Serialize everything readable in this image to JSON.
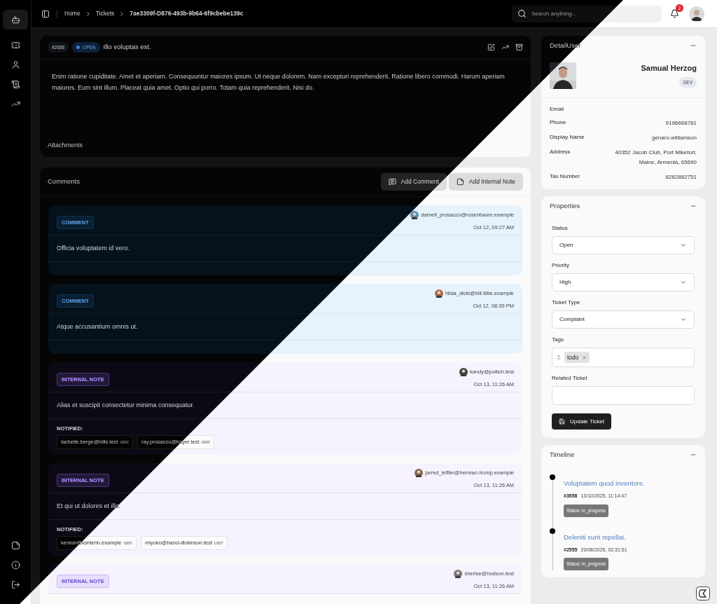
{
  "breadcrumb": [
    "Home",
    "Tickets",
    "7ae3309f-D876-493b-9b64-6f9cbebe139c"
  ],
  "search": {
    "placeholder": "Search anything..."
  },
  "notifications": {
    "count": "2"
  },
  "ticket": {
    "number": "#2658",
    "status": "OPEN",
    "title": "Illo voluptas est.",
    "description": "Enim ratione cupiditate. Amet et aperiam. Consequuntur maiores ipsum. Ut neque dolorem. Nam excepturi reprehenderit. Ratione libero commodi. Harum aperiam maiores. Eum sint illum. Placeat quia amet. Optio qui porro. Totam quia reprehenderit. Nisi do.",
    "attachments_label": "Attachments"
  },
  "comments": {
    "title": "Comments",
    "buttons": [
      {
        "label": "Add Comment",
        "kind": "comment"
      },
      {
        "label": "Add Internal Note",
        "kind": "note"
      }
    ],
    "items": [
      {
        "kind": "comment",
        "badge": "COMMENT",
        "author": "darnell_prosacco@rosenbaum.example",
        "time": "Oct 12, 09:27 AM",
        "body": "Officia voluptatem id vero."
      },
      {
        "kind": "comment",
        "badge": "COMMENT",
        "author": "hilda_dicki@hill-little.example",
        "time": "Oct 12, 08:39 PM",
        "body": "Atque accusantium omnis ut."
      },
      {
        "kind": "note",
        "badge": "INTERNAL NOTE",
        "author": "kandy@pollich.test",
        "time": "Oct 13, 11:26 AM",
        "body": "Alias et suscipit consectetur minima consequatur.",
        "notified_label": "NOTIFIED:",
        "notified": [
          {
            "email": "lachelle.berge@hills.test",
            "tag": "user"
          },
          {
            "email": "ray.prosacco@bayer.test",
            "tag": "user"
          }
        ]
      },
      {
        "kind": "note",
        "badge": "INTERNAL NOTE",
        "author": "jarred_leffler@herman-tromp.example",
        "time": "Oct 13, 11:26 AM",
        "body": "Et qui ut dolores et illo.",
        "notified_label": "NOTIFIED:",
        "notified": [
          {
            "email": "kenton@kshlerin.example",
            "tag": "user"
          },
          {
            "email": "miyoko@hand-dickinson.test",
            "tag": "user"
          }
        ]
      },
      {
        "kind": "note",
        "badge": "INTERNAL NOTE",
        "author": "sherise@hudson.test",
        "time": "Oct 13, 11:26 AM"
      }
    ]
  },
  "detail_user": {
    "title": "DetailUser",
    "name": "Samual Herzog",
    "role": "DEV",
    "fields": [
      {
        "label": "Email"
      },
      {
        "label": "Phone",
        "value": "9196668781"
      },
      {
        "label": "Display Name",
        "value": "genaro.williamson"
      },
      {
        "label": "Address",
        "value": "40352 Jacob Club, Port Mikefort, Maine, Armenia, 65690"
      },
      {
        "label": "Tax Number",
        "value": "8262882751"
      }
    ]
  },
  "properties": {
    "title": "Properties",
    "fields": [
      {
        "kind": "select",
        "label": "Status",
        "value": "Open"
      },
      {
        "kind": "select",
        "label": "Priority",
        "value": "High"
      },
      {
        "kind": "select",
        "label": "Ticket Type",
        "value": "Complaint"
      },
      {
        "kind": "tags",
        "label": "Tags",
        "tags": [
          "todo"
        ]
      },
      {
        "kind": "input",
        "label": "Related Ticket"
      }
    ],
    "button": "Update Ticket"
  },
  "timeline": {
    "title": "Timeline",
    "items": [
      {
        "title": "Voluptatem quod inventore.",
        "number": "#3658",
        "datetime": "13/10/2025, 11:14:47",
        "status": "Status: in_progress"
      },
      {
        "title": "Deleniti sunt repellat.",
        "number": "#2555",
        "datetime": "23/08/2025, 02:31:51",
        "status": "Status: in_progress"
      }
    ]
  }
}
